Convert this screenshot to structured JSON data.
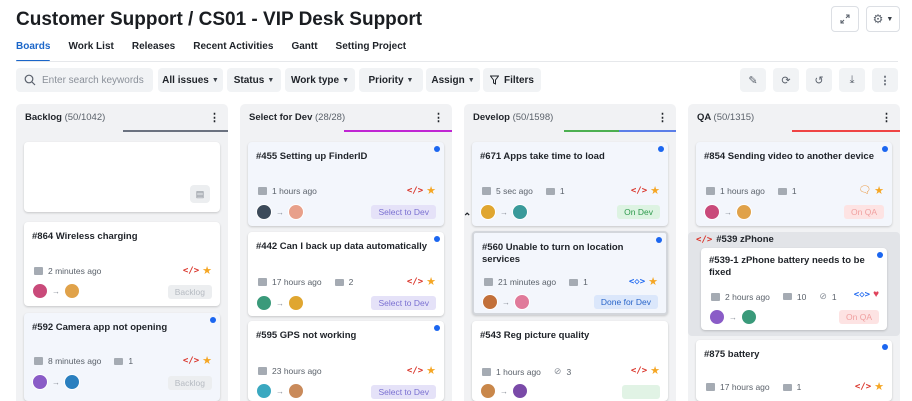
{
  "header": {
    "title": "Customer Support / CS01 - VIP Desk Support",
    "expand_icon": "expand-icon",
    "settings_icon": "gear-icon"
  },
  "tabs": [
    {
      "label": "Boards",
      "active": true
    },
    {
      "label": "Work List"
    },
    {
      "label": "Releases"
    },
    {
      "label": "Recent Activities"
    },
    {
      "label": "Gantt"
    },
    {
      "label": "Setting Project"
    }
  ],
  "toolbar": {
    "search_placeholder": "Enter search keywords",
    "filters": [
      "All issues",
      "Status",
      "Work type",
      "Priority",
      "Assign"
    ],
    "filters_label": "Filters",
    "icons": [
      "edit-icon",
      "refresh-icon",
      "history-icon",
      "download-icon",
      "more-icon"
    ]
  },
  "columns": [
    {
      "name": "Backlog",
      "count": "(50/1042)",
      "accent": "#6b7280",
      "cards": [
        {
          "title": "",
          "placeholder": true
        },
        {
          "title": "#864 Wireless charging",
          "time": "2 minutes ago",
          "comments": "",
          "status": "Backlog"
        },
        {
          "title": "#592 Camera app not opening",
          "time": "8 minutes ago",
          "comments": "1",
          "status": "Backlog"
        }
      ]
    },
    {
      "name": "Select for Dev",
      "count": "(28/28)",
      "accent": "#c026d3",
      "cards": [
        {
          "title": "#455 Setting up FinderID",
          "time": "1 hours ago",
          "comments": "",
          "status": "Select to Dev"
        },
        {
          "title": "#442 Can I back up data automatically",
          "time": "17 hours ago",
          "comments": "2",
          "status": "Select to Dev"
        },
        {
          "title": "#595 GPS not working",
          "time": "23 hours ago",
          "comments": "",
          "status": "Select to Dev"
        }
      ]
    },
    {
      "name": "Develop",
      "count": "(50/1598)",
      "accent": "#4caf50",
      "cards": [
        {
          "title": "#671 Apps take time to load",
          "time": "5 sec ago",
          "comments": "1",
          "status": "On Dev"
        },
        {
          "title": "#560 Unable to turn on location services",
          "time": "21 minutes ago",
          "comments": "1",
          "status": "Done for Dev"
        },
        {
          "title": "#543 Reg picture quality",
          "time": "1 hours ago",
          "attachments": "3",
          "status": ""
        }
      ]
    },
    {
      "name": "QA",
      "count": "(50/1315)",
      "accent": "#ef4444",
      "cards": [
        {
          "title": "#854 Sending video to another device",
          "time": "1 hours ago",
          "comments": "1",
          "status": "On QA"
        },
        {
          "title": "#539-1 zPhone battery needs to be fixed",
          "time": "2 hours ago",
          "comments": "10",
          "attachments": "1",
          "status": "On QA"
        },
        {
          "title": "#875 battery",
          "time": "17 hours ago",
          "comments": "1",
          "status": ""
        }
      ],
      "group": {
        "title": "#539 zPhone"
      }
    }
  ]
}
